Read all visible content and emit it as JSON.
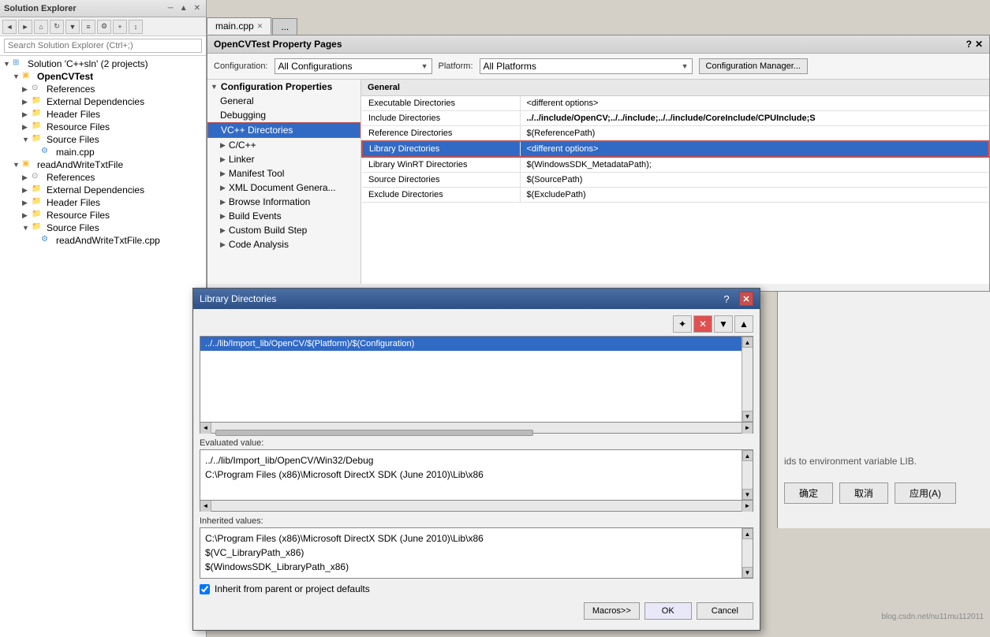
{
  "solution_explorer": {
    "title": "Solution Explorer",
    "search_placeholder": "Search Solution Explorer (Ctrl+;)",
    "solution_label": "Solution 'C++sln' (2 projects)",
    "tree": [
      {
        "id": "solution",
        "label": "Solution 'C++sln' (2 projects)",
        "indent": 0,
        "type": "solution",
        "expanded": true
      },
      {
        "id": "opencvtest",
        "label": "OpenCVTest",
        "indent": 1,
        "type": "project",
        "expanded": true,
        "bold": true
      },
      {
        "id": "references1",
        "label": "References",
        "indent": 2,
        "type": "ref"
      },
      {
        "id": "extdep1",
        "label": "External Dependencies",
        "indent": 2,
        "type": "folder"
      },
      {
        "id": "headerfiles1",
        "label": "Header Files",
        "indent": 2,
        "type": "folder"
      },
      {
        "id": "resourcefiles1",
        "label": "Resource Files",
        "indent": 2,
        "type": "folder"
      },
      {
        "id": "sourcefiles1",
        "label": "Source Files",
        "indent": 2,
        "type": "folder",
        "expanded": true
      },
      {
        "id": "maincpp",
        "label": "main.cpp",
        "indent": 3,
        "type": "cpp"
      },
      {
        "id": "readandwrite",
        "label": "readAndWriteTxtFile",
        "indent": 1,
        "type": "project",
        "expanded": true
      },
      {
        "id": "references2",
        "label": "References",
        "indent": 2,
        "type": "ref"
      },
      {
        "id": "extdep2",
        "label": "External Dependencies",
        "indent": 2,
        "type": "folder"
      },
      {
        "id": "headerfiles2",
        "label": "Header Files",
        "indent": 2,
        "type": "folder"
      },
      {
        "id": "resourcefiles2",
        "label": "Resource Files",
        "indent": 2,
        "type": "folder"
      },
      {
        "id": "sourcefiles2",
        "label": "Source Files",
        "indent": 2,
        "type": "folder",
        "expanded": true
      },
      {
        "id": "rawfile",
        "label": "readAndWriteTxtFile.cpp",
        "indent": 3,
        "type": "cpp"
      }
    ]
  },
  "tabs": [
    {
      "id": "maincpp-tab",
      "label": "main.cpp",
      "active": true,
      "closable": true
    },
    {
      "id": "other-tab",
      "label": "...",
      "active": false,
      "closable": false
    }
  ],
  "property_pages": {
    "title": "OpenCVTest Property Pages",
    "config_label": "Configuration:",
    "config_value": "All Configurations",
    "platform_label": "Platform:",
    "platform_value": "All Platforms",
    "config_mgr_btn": "Configuration Manager...",
    "left_tree": [
      {
        "id": "config-props",
        "label": "Configuration Properties",
        "indent": 0,
        "arrow": "▼",
        "header": true
      },
      {
        "id": "general",
        "label": "General",
        "indent": 1,
        "arrow": ""
      },
      {
        "id": "debugging",
        "label": "Debugging",
        "indent": 1,
        "arrow": ""
      },
      {
        "id": "vc-dirs",
        "label": "VC++ Directories",
        "indent": 1,
        "arrow": "",
        "selected": true
      },
      {
        "id": "cpp",
        "label": "C/C++",
        "indent": 1,
        "arrow": "▶"
      },
      {
        "id": "linker",
        "label": "Linker",
        "indent": 1,
        "arrow": "▶"
      },
      {
        "id": "manifest-tool",
        "label": "Manifest Tool",
        "indent": 1,
        "arrow": "▶"
      },
      {
        "id": "xml-doc",
        "label": "XML Document Genera...",
        "indent": 1,
        "arrow": "▶"
      },
      {
        "id": "browse-info",
        "label": "Browse Information",
        "indent": 1,
        "arrow": "▶"
      },
      {
        "id": "build-events",
        "label": "Build Events",
        "indent": 1,
        "arrow": "▶"
      },
      {
        "id": "custom-build",
        "label": "Custom Build Step",
        "indent": 1,
        "arrow": "▶"
      },
      {
        "id": "code-analysis",
        "label": "Code Analysis",
        "indent": 1,
        "arrow": "▶"
      }
    ],
    "right_header": "General",
    "table_rows": [
      {
        "id": "exec-dirs",
        "label": "Executable Directories",
        "value": "<different options>",
        "highlighted": false
      },
      {
        "id": "include-dirs",
        "label": "Include Directories",
        "value": "../../include/OpenCV;../../include;../../include/CoreInclude/CPUInclude;S",
        "highlighted": false,
        "bold_value": true
      },
      {
        "id": "ref-dirs",
        "label": "Reference Directories",
        "value": "$(ReferencePath)",
        "highlighted": false
      },
      {
        "id": "lib-dirs",
        "label": "Library Directories",
        "value": "<different options>",
        "highlighted": true
      },
      {
        "id": "libwinrt-dirs",
        "label": "Library WinRT Directories",
        "value": "$(WindowsSDK_MetadataPath);",
        "highlighted": false
      },
      {
        "id": "src-dirs",
        "label": "Source Directories",
        "value": "$(SourcePath)",
        "highlighted": false
      },
      {
        "id": "excl-dirs",
        "label": "Exclude Directories",
        "value": "$(ExcludePath)",
        "highlighted": false
      }
    ]
  },
  "lib_dialog": {
    "title": "Library Directories",
    "toolbar_buttons": [
      "add-icon",
      "delete-icon",
      "move-down-icon",
      "move-up-icon"
    ],
    "list_items": [
      {
        "id": "lib-path",
        "label": "../../lib/Import_lib/OpenCV/$(Platform)/$(Configuration)",
        "selected": true
      }
    ],
    "eval_label": "Evaluated value:",
    "eval_lines": [
      "../../lib/Import_lib/OpenCV/Win32/Debug",
      "C:\\Program Files (x86)\\Microsoft DirectX SDK (June 2010)\\Lib\\x86"
    ],
    "inherited_label": "Inherited values:",
    "inherited_lines": [
      "C:\\Program Files (x86)\\Microsoft DirectX SDK (June 2010)\\Lib\\x86",
      "$(VC_LibraryPath_x86)",
      "$(WindowsSDK_LibraryPath_x86)"
    ],
    "checkbox_label": "Inherit from parent or project defaults",
    "checkbox_checked": true,
    "macros_btn": "Macros>>",
    "ok_btn": "OK",
    "cancel_btn": "Cancel",
    "close_btn": "✕",
    "help_icon": "?",
    "add_btn_symbol": "✦",
    "del_btn_symbol": "✕",
    "down_btn_symbol": "▼",
    "up_btn_symbol": "▲"
  },
  "bottom_bar": {
    "text": ""
  }
}
